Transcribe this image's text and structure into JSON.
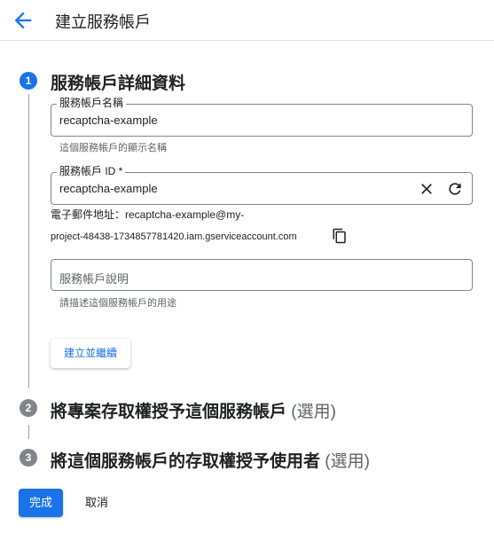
{
  "header": {
    "title": "建立服務帳戶",
    "back_icon": "arrow-back-icon"
  },
  "steps": [
    {
      "number": "1",
      "title": "服務帳戶詳細資料",
      "optional": "",
      "active": true
    },
    {
      "number": "2",
      "title": "將專案存取權授予這個服務帳戶",
      "optional": "(選用)",
      "active": false
    },
    {
      "number": "3",
      "title": "將這個服務帳戶的存取權授予使用者",
      "optional": "(選用)",
      "active": false
    }
  ],
  "form": {
    "name_field": {
      "label": "服務帳戶名稱",
      "value": "recaptcha-example",
      "hint": "這個服務帳戶的顯示名稱"
    },
    "id_field": {
      "label": "服務帳戶 ID *",
      "value": "recaptcha-example",
      "clear_icon": "close-icon",
      "refresh_icon": "refresh-icon"
    },
    "email_line1": "電子郵件地址：recaptcha-example@my-",
    "email_line2": "project-48438-1734857781420.iam.gserviceaccount.com",
    "copy_icon": "copy-icon",
    "description_field": {
      "placeholder": "服務帳戶說明",
      "value": "",
      "hint": "請描述這個服務帳戶的用途"
    },
    "create_button": "建立並繼續"
  },
  "footer": {
    "done_button": "完成",
    "cancel_button": "取消"
  },
  "colors": {
    "accent": "#1a73e8",
    "inactive_step": "#80868b"
  }
}
